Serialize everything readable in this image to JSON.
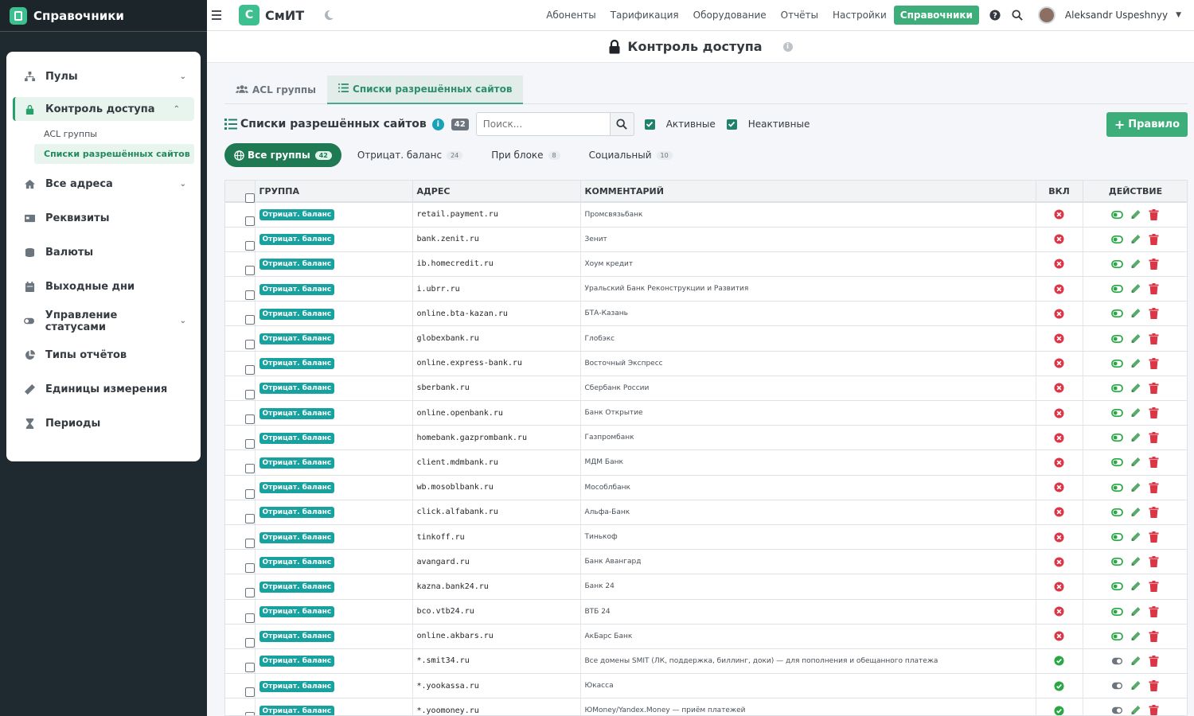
{
  "brand": "Справочники",
  "sidebar": {
    "items": [
      {
        "label": "Пулы",
        "icon": "network-icon",
        "chevron": true
      },
      {
        "label": "Контроль доступа",
        "icon": "lock-icon",
        "chevron": true,
        "active": true
      },
      {
        "label": "Все адреса",
        "icon": "home-icon",
        "chevron": true
      },
      {
        "label": "Реквизиты",
        "icon": "card-icon"
      },
      {
        "label": "Валюты",
        "icon": "coins-icon"
      },
      {
        "label": "Выходные дни",
        "icon": "calendar-icon"
      },
      {
        "label": "Управление статусами",
        "icon": "toggle-icon",
        "chevron": true
      },
      {
        "label": "Типы отчётов",
        "icon": "pie-icon"
      },
      {
        "label": "Единицы измерения",
        "icon": "ruler-icon"
      },
      {
        "label": "Периоды",
        "icon": "hourglass-icon"
      }
    ],
    "sub": [
      "ACL группы",
      "Списки разрешённых сайтов"
    ]
  },
  "topbar": {
    "logo_letter": "С",
    "logo_text": "СмИТ",
    "nav": [
      "Абоненты",
      "Тарификация",
      "Оборудование",
      "Отчёты",
      "Настройки",
      "Справочники"
    ],
    "user": "Aleksandr Uspeshnyy"
  },
  "page": {
    "title": "Контроль доступа",
    "info": "i"
  },
  "tabs": [
    "ACL группы",
    "Списки разрешённых сайтов"
  ],
  "toolbar": {
    "title": "Списки разрешённых сайтов",
    "count": "42",
    "search_placeholder": "Поиск...",
    "active_label": "Активные",
    "inactive_label": "Неактивные",
    "add_label": "Правило"
  },
  "pills": [
    {
      "label": "Все группы",
      "count": "42"
    },
    {
      "label": "Отрицат. баланс",
      "count": "24"
    },
    {
      "label": "При блоке",
      "count": "8"
    },
    {
      "label": "Социальный",
      "count": "10"
    }
  ],
  "table": {
    "headers": [
      "ГРУППА",
      "АДРЕС",
      "КОММЕНТАРИЙ",
      "ВКЛ",
      "ДЕЙСТВИЕ"
    ],
    "rows": [
      {
        "group": "Отрицат. баланс",
        "addr": "retail.payment.ru",
        "cmt": "Промсвязьбанк",
        "on": false
      },
      {
        "group": "Отрицат. баланс",
        "addr": "bank.zenit.ru",
        "cmt": "Зенит",
        "on": false
      },
      {
        "group": "Отрицат. баланс",
        "addr": "ib.homecredit.ru",
        "cmt": "Хоум кредит",
        "on": false
      },
      {
        "group": "Отрицат. баланс",
        "addr": "i.ubrr.ru",
        "cmt": "Уральский Банк Реконструкции и Развития",
        "on": false
      },
      {
        "group": "Отрицат. баланс",
        "addr": "online.bta-kazan.ru",
        "cmt": "БТА-Казань",
        "on": false
      },
      {
        "group": "Отрицат. баланс",
        "addr": "globexbank.ru",
        "cmt": "Глобэкс",
        "on": false
      },
      {
        "group": "Отрицат. баланс",
        "addr": "online.express-bank.ru",
        "cmt": "Восточный Экспресс",
        "on": false
      },
      {
        "group": "Отрицат. баланс",
        "addr": "sberbank.ru",
        "cmt": "Сбербанк России",
        "on": false
      },
      {
        "group": "Отрицат. баланс",
        "addr": "online.openbank.ru",
        "cmt": "Банк Открытие",
        "on": false
      },
      {
        "group": "Отрицат. баланс",
        "addr": "homebank.gazprombank.ru",
        "cmt": "Газпромбанк",
        "on": false
      },
      {
        "group": "Отрицат. баланс",
        "addr": "client.mdmbank.ru",
        "cmt": "МДМ Банк",
        "on": false
      },
      {
        "group": "Отрицат. баланс",
        "addr": "wb.mosoblbank.ru",
        "cmt": "Мособлбанк",
        "on": false
      },
      {
        "group": "Отрицат. баланс",
        "addr": "click.alfabank.ru",
        "cmt": "Альфа-Банк",
        "on": false
      },
      {
        "group": "Отрицат. баланс",
        "addr": "tinkoff.ru",
        "cmt": "Тинькоф",
        "on": false
      },
      {
        "group": "Отрицат. баланс",
        "addr": "avangard.ru",
        "cmt": "Банк Авангард",
        "on": false
      },
      {
        "group": "Отрицат. баланс",
        "addr": "kazna.bank24.ru",
        "cmt": "Банк 24",
        "on": false
      },
      {
        "group": "Отрицат. баланс",
        "addr": "bco.vtb24.ru",
        "cmt": "ВТБ 24",
        "on": false
      },
      {
        "group": "Отрицат. баланс",
        "addr": "online.akbars.ru",
        "cmt": "АкБарс Банк",
        "on": false
      },
      {
        "group": "Отрицат. баланс",
        "addr": "*.smit34.ru",
        "cmt": "Все домены SMIT (ЛК, поддержка, биллинг, доки) — для пополнения и обещанного платежа",
        "on": true
      },
      {
        "group": "Отрицат. баланс",
        "addr": "*.yookassa.ru",
        "cmt": "Юкасса",
        "on": true
      },
      {
        "group": "Отрицат. баланс",
        "addr": "*.yoomoney.ru",
        "cmt": "ЮMoney/Yandex.Money — приём платежей",
        "on": true
      }
    ]
  },
  "colors": {
    "accent": "#3dae7a",
    "badge": "#17a2a0",
    "danger": "#dc3545",
    "success": "#28a745"
  }
}
